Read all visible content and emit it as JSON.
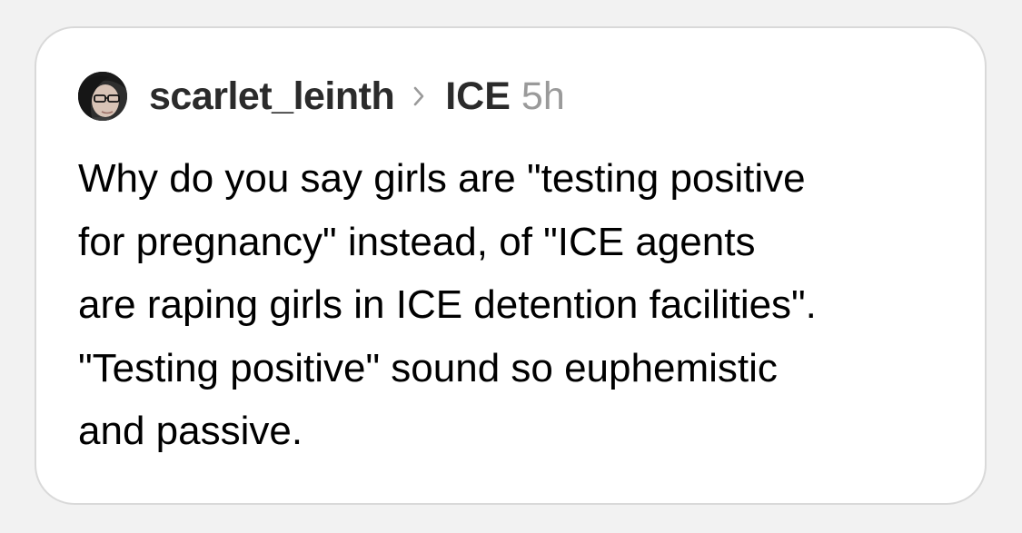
{
  "post": {
    "author": "scarlet_leinth",
    "community": "ICE",
    "age": "5h",
    "body_lines": [
      "Why do you say girls are \"testing positive",
      "for pregnancy\" instead, of \"ICE agents",
      "are raping girls in ICE detention facilities\".",
      "\"Testing positive\" sound so euphemistic",
      "and passive."
    ]
  },
  "icons": {
    "breadcrumb_separator": "chevron-right-icon",
    "avatar": "user-avatar"
  },
  "colors": {
    "card_background": "#ffffff",
    "card_border": "#d9d9d9",
    "author_text": "#2b2b2b",
    "timestamp_text": "#9a9a9a",
    "body_text": "#000000"
  }
}
